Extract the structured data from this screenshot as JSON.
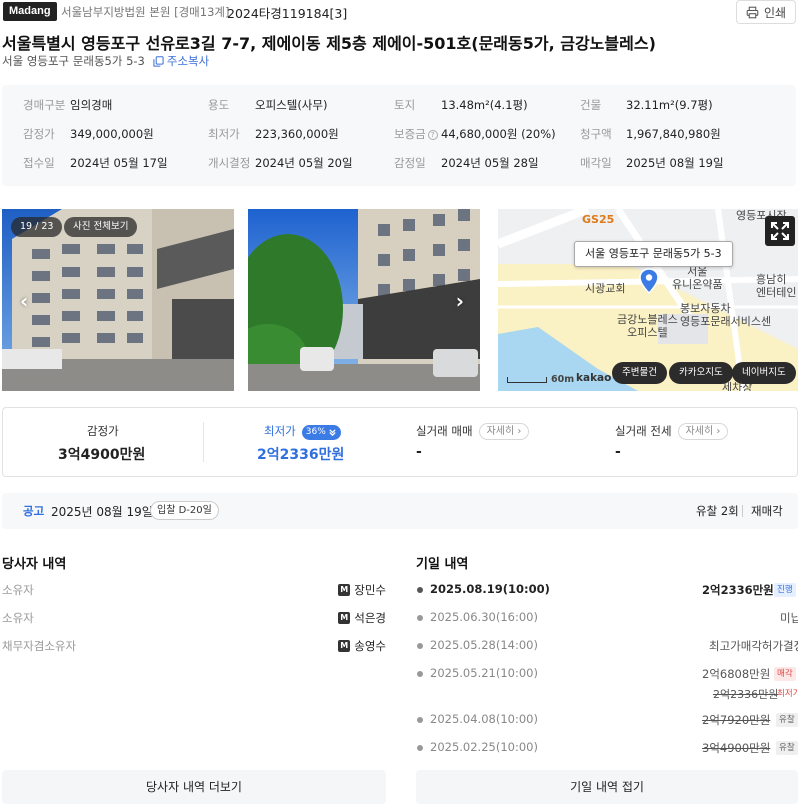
{
  "header": {
    "logo": "Madang",
    "court": "서울남부지방법원 본원 [경매13계]",
    "case_no": "2024타경119184[3]",
    "print_label": "인쇄"
  },
  "property": {
    "title": "서울특별시 영등포구 선유로3길 7-7, 제에이동 제5층 제에이-501호(문래동5가, 금강노블레스)",
    "short_address": "서울 영등포구 문래동5가 5-3",
    "copy_label": "주소복사"
  },
  "info": {
    "row1": [
      {
        "label": "경매구분",
        "value": "임의경매"
      },
      {
        "label": "용도",
        "value": "오피스텔(사무)"
      },
      {
        "label": "토지",
        "value": "13.48m²(4.1평)"
      },
      {
        "label": "건물",
        "value": "32.11m²(9.7평)"
      }
    ],
    "row2": [
      {
        "label": "감정가",
        "value": "349,000,000원"
      },
      {
        "label": "최저가",
        "value": "223,360,000원"
      },
      {
        "label": "보증금",
        "value": "44,680,000원 (20%)"
      },
      {
        "label": "청구액",
        "value": "1,967,840,980원"
      }
    ],
    "row3": [
      {
        "label": "접수일",
        "value": "2024년 05월 17일"
      },
      {
        "label": "개시결정",
        "value": "2024년 05월 20일"
      },
      {
        "label": "감정일",
        "value": "2024년 05월 28일"
      },
      {
        "label": "매각일",
        "value": "2025년 08월 19일"
      }
    ]
  },
  "photos": {
    "counter": "19 / 23",
    "view_all": "사진 전체보기",
    "prev_icon": "chevron-left-icon",
    "next_icon": "chevron-right-icon"
  },
  "map": {
    "popup": "서울 영등포구 문래동5가 5-3",
    "labels": {
      "gs25": "GS25",
      "church": "시광교회",
      "pharmacy": "서울\n유니온약품",
      "building": "금강노블레스\n오피스텔",
      "service": "봉보자동차\n영등포문래서비스센",
      "top": "영등포시장",
      "right": "흥남히\n엔터테인",
      "bottom": "세차장"
    },
    "scale": "60m",
    "brand": "kakao",
    "buttons": [
      "주변물건",
      "카카오지도",
      "네이버지도"
    ]
  },
  "prices": {
    "appraisal": {
      "label": "감정가",
      "value": "3억4900만원"
    },
    "minimum": {
      "label": "최저가",
      "percent": "36%",
      "value": "2억2336만원"
    },
    "trade_sale": {
      "label": "실거래 매매",
      "detail": "자세히",
      "value": "-"
    },
    "trade_jeonse": {
      "label": "실거래 전세",
      "detail": "자세히",
      "value": "-"
    }
  },
  "notice": {
    "label": "공고",
    "date": "2025년 08월 19일",
    "dday": "입찰 D-20일",
    "fail_count": "유찰 2회",
    "resale": "재매각"
  },
  "parties": {
    "title": "당사자 내역",
    "rows": [
      {
        "role": "소유자",
        "badge": "M",
        "name": "장민수"
      },
      {
        "role": "소유자",
        "badge": "M",
        "name": "석은경"
      },
      {
        "role": "채무자겸소유자",
        "badge": "M",
        "name": "송영수"
      }
    ],
    "more_label": "당사자 내역 더보기"
  },
  "dates": {
    "title": "기일 내역",
    "rows": [
      {
        "date": "2025.08.19(10:00)",
        "amount": "2억2336만원",
        "status": "진행"
      },
      {
        "date": "2025.06.30(16:00)",
        "amount": "",
        "status": "미납"
      },
      {
        "date": "2025.05.28(14:00)",
        "amount": "최고가매각허가결정",
        "status": ""
      },
      {
        "date": "2025.05.21(10:00)",
        "amount": "2억6808만원",
        "status": "매각",
        "sub_amount": "2억2336만원",
        "sub_status": "최저가"
      },
      {
        "date": "2025.04.08(10:00)",
        "amount": "2억7920만원",
        "status": "유찰"
      },
      {
        "date": "2025.02.25(10:00)",
        "amount": "3억4900만원",
        "status": "유찰"
      }
    ],
    "collapse_label": "기일 내역 접기"
  },
  "colors": {
    "accent": "#2f6fe0",
    "text": "#222222",
    "muted": "#999999",
    "panel": "#f7f8fa",
    "sold": "#e04848",
    "progress": "#3b7be6"
  }
}
